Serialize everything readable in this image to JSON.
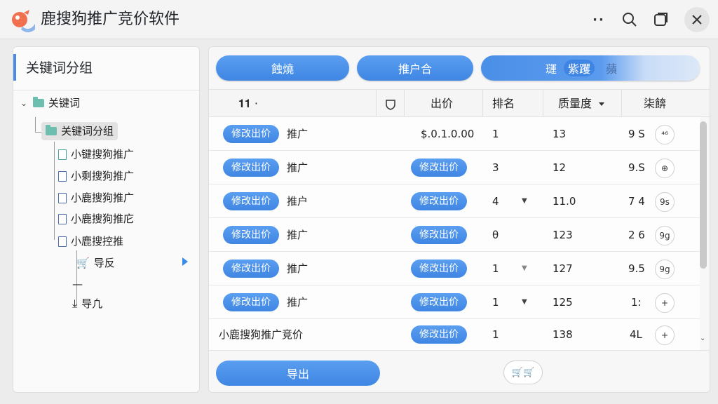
{
  "app": {
    "title": "鹿搜狗推广竞价软件"
  },
  "titlebar": {
    "more": "··",
    "search": "⌕",
    "restore": "❐",
    "close": "✕"
  },
  "left": {
    "header": "关键词分组",
    "tree": [
      {
        "label": "关键词"
      },
      {
        "label": "关键词分组"
      },
      {
        "label": "小键搜狗推广"
      },
      {
        "label": "小剩搜狗推广"
      },
      {
        "label": "小鹿搜狗推广"
      },
      {
        "label": "小鹿搜狗推庀"
      },
      {
        "label": "小鹿搜控推"
      },
      {
        "label": "导反"
      },
      {
        "label": "—"
      },
      {
        "label": "导凢"
      }
    ]
  },
  "toolbar": {
    "btn1": "蝕燒",
    "btn2": "推户合",
    "btn3": {
      "a": "璭",
      "b": "紫躩",
      "c": "蘋"
    }
  },
  "table": {
    "headers": {
      "c1": "𝟏𝟏 ·",
      "price": "出价",
      "rank": "排名",
      "quality": "质量度",
      "last": "柒餴"
    },
    "edit_label": "修改出价",
    "rows": [
      {
        "name": "推广",
        "price_text": "$.0.1.0.00",
        "rank": "1",
        "quality": "13",
        "score": "9 S",
        "icon": "⁴⁶"
      },
      {
        "name": "推广",
        "rank": "3",
        "quality": "12",
        "score": "9.S",
        "icon": "⊕"
      },
      {
        "name": "推户",
        "rank": "4",
        "quality": "11.0",
        "score": "7 4",
        "icon": "9s"
      },
      {
        "name": "推广",
        "rank": "θ",
        "quality": "123",
        "score": "2 6",
        "icon": "9g"
      },
      {
        "name": "推广",
        "rank": "1",
        "quality": "127",
        "score": "9.5",
        "icon": "9g"
      },
      {
        "name": "推广",
        "rank": "1",
        "quality": "125",
        "score": "1:",
        "icon": "+"
      },
      {
        "name": "小鹿搜狗推广竞价",
        "rank": "1",
        "quality": "138",
        "score": "4L",
        "icon": "+"
      }
    ]
  },
  "footer": {
    "export": "导出",
    "cart": "🛒🛒"
  },
  "colors": {
    "accent": "#4a8be6",
    "folder": "#6cbfae"
  }
}
